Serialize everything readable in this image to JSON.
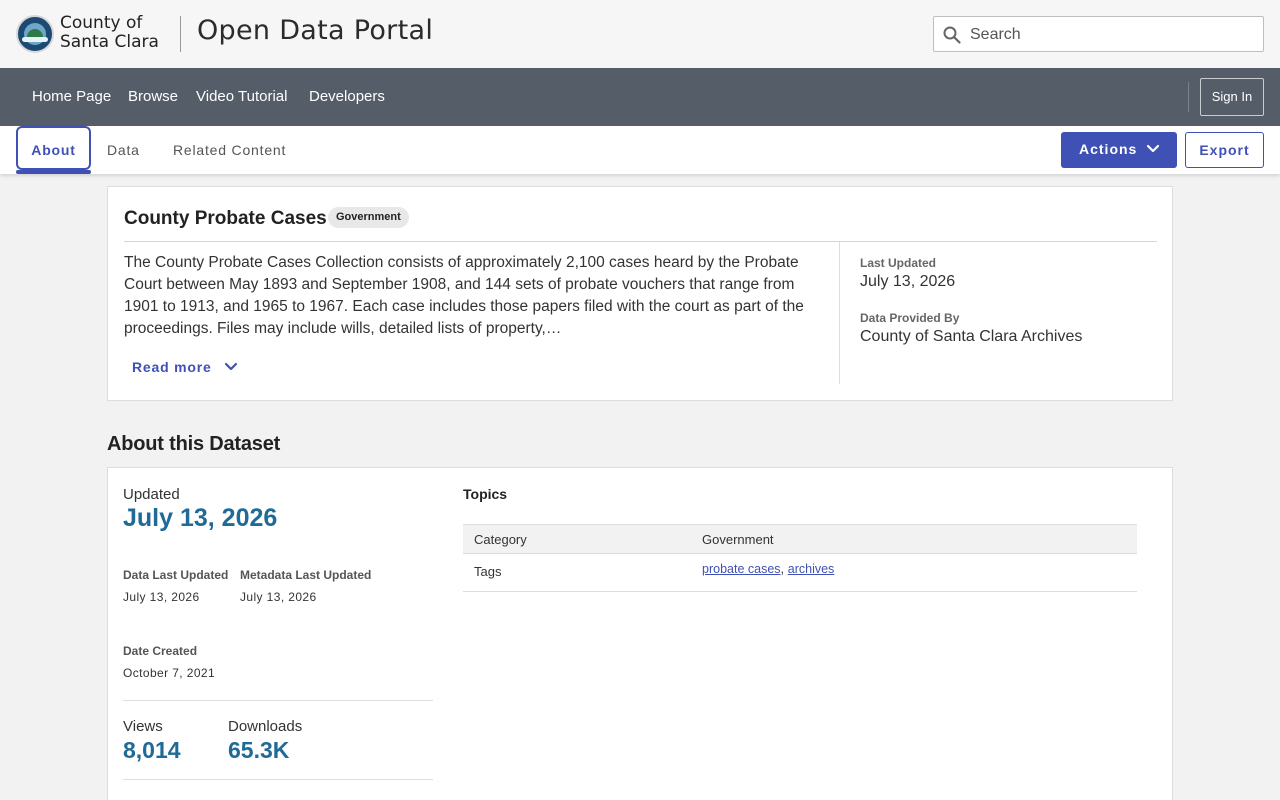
{
  "header": {
    "logo_line1": "County of",
    "logo_line2": "Santa Clara",
    "portal_title": "Open Data Portal",
    "search_placeholder": "Search"
  },
  "nav": {
    "links": [
      "Home Page",
      "Browse",
      "Video Tutorial",
      "Developers"
    ],
    "sign_in": "Sign In"
  },
  "tabs": {
    "items": [
      "About",
      "Data",
      "Related Content"
    ],
    "active": "About",
    "actions_label": "Actions",
    "export_label": "Export"
  },
  "summary": {
    "title": "County Probate Cases",
    "category_badge": "Government",
    "description": "The County Probate Cases Collection consists of approximately 2,100 cases heard by the Probate Court between May 1893 and September 1908, and 144 sets of probate vouchers that range from 1901 to 1913, and 1965 to 1967. Each case includes those papers filed with the court as part of the proceedings. Files may include wills, detailed lists of property,…",
    "read_more": "Read more",
    "last_updated_label": "Last Updated",
    "last_updated_value": "July 13, 2026",
    "provided_by_label": "Data Provided By",
    "provided_by_value": "County of Santa Clara Archives"
  },
  "about": {
    "heading": "About this Dataset",
    "updated_label": "Updated",
    "updated_value": "July 13, 2026",
    "data_last_updated_label": "Data Last Updated",
    "data_last_updated_value": "July 13, 2026",
    "metadata_last_updated_label": "Metadata Last Updated",
    "metadata_last_updated_value": "July 13, 2026",
    "date_created_label": "Date Created",
    "date_created_value": "October 7, 2021",
    "views_label": "Views",
    "views_value": "8,014",
    "downloads_label": "Downloads",
    "downloads_value": "65.3K",
    "topics_title": "Topics",
    "topics_rows": {
      "category_label": "Category",
      "category_value": "Government",
      "tags_label": "Tags",
      "tags": [
        "probate cases",
        "archives"
      ],
      "tag_separator": ", "
    }
  },
  "colors": {
    "accent": "#3f51b5",
    "nav_bg": "#555d68",
    "stat_value": "#1f6a96"
  }
}
